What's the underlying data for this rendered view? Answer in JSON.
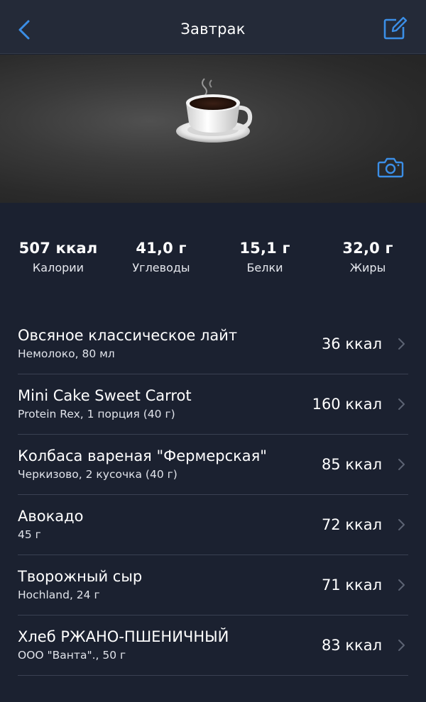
{
  "header": {
    "title": "Завтрак",
    "back_icon": "chevron-left-icon",
    "edit_icon": "edit-icon"
  },
  "hero": {
    "image": "coffee-cup",
    "camera_icon": "camera-icon"
  },
  "summary": [
    {
      "value": "507 ккал",
      "label": "Калории"
    },
    {
      "value": "41,0 г",
      "label": "Углеводы"
    },
    {
      "value": "15,1 г",
      "label": "Белки"
    },
    {
      "value": "32,0 г",
      "label": "Жиры"
    }
  ],
  "items": [
    {
      "name": "Овсяное классическое лайт",
      "detail": "Немолоко, 80 мл",
      "kcal": "36 ккал"
    },
    {
      "name": "Mini Cake Sweet Carrot",
      "detail": "Protein Rex, 1 порция (40 г)",
      "kcal": "160 ккал"
    },
    {
      "name": "Колбаса вареная \"Фермерская\"",
      "detail": "Черкизово, 2 кусочка (40 г)",
      "kcal": "85 ккал"
    },
    {
      "name": "Авокадо",
      "detail": "45 г",
      "kcal": "72 ккал"
    },
    {
      "name": "Творожный сыр",
      "detail": "Hochland, 24 г",
      "kcal": "71 ккал"
    },
    {
      "name": "Хлеб РЖАНО-ПШЕНИЧНЫЙ",
      "detail": "ООО \"Ванта\"., 50 г",
      "kcal": "83 ккал"
    }
  ],
  "colors": {
    "accent": "#3b8ee6",
    "background": "#1b2130",
    "header": "#242a38",
    "divider": "#3a4152"
  }
}
